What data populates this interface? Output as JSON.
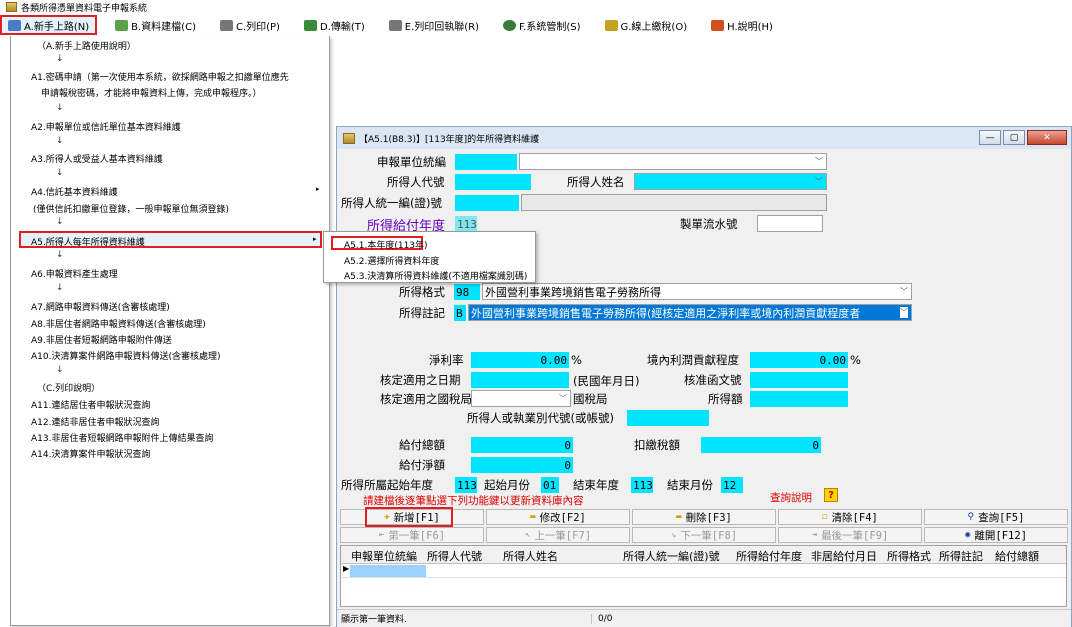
{
  "app": {
    "title": "各類所得憑單資料電子申報系統"
  },
  "menubar": {
    "items": [
      {
        "label": "A.新手上路(N)",
        "icon": "pencil-icon",
        "color": "#4a7bc8"
      },
      {
        "label": "B.資料建檔(C)",
        "icon": "form-icon",
        "color": "#5aa04a"
      },
      {
        "label": "C.列印(P)",
        "icon": "printer-icon",
        "color": "#666666"
      },
      {
        "label": "D.傳輸(T)",
        "icon": "transfer-icon",
        "color": "#3a8a3a"
      },
      {
        "label": "E.列印回執聯(R)",
        "icon": "printer-icon",
        "color": "#666666"
      },
      {
        "label": "F.系統管制(S)",
        "icon": "gear-icon",
        "color": "#3a7a3a"
      },
      {
        "label": "G.線上繳稅(O)",
        "icon": "money-icon",
        "color": "#c8a020"
      },
      {
        "label": "H.說明(H)",
        "icon": "help-icon",
        "color": "#d05020"
      }
    ]
  },
  "dropdown": {
    "items": [
      "（A.新手上路使用說明）",
      "A1.密碼申請（第一次使用本系統，欲採網路申報之扣繳單位應先",
      "申請報稅密碼，才能將申報資料上傳，完成申報程序。）",
      "A2.申報單位或信託單位基本資料維護",
      "A3.所得人或受益人基本資料維護",
      "A4.信託基本資料維護",
      "(僅供信託扣繳單位登錄，一般申報單位無須登錄)",
      "A5.所得人每年所得資料維護",
      "A6.申報資料產生處理",
      "A7.網路申報資料傳送(含審核處理)",
      "A8.非居住者網路申報資料傳送(含審核處理)",
      "A9.非居住者短報網路申報附件傳送",
      "A10.決清算案件網路申報資料傳送(含審核處理)",
      "（C.列印說明）",
      "A11.連結居住者申報狀況查詢",
      "A12.連結非居住者申報狀況查詢",
      "A13.非居住者短報網路申報附件上傳結果查詢",
      "A14.決清算案件申報狀況查詢"
    ],
    "arrow": "↓",
    "submenu_arrow": "▸"
  },
  "submenu": {
    "items": [
      "A5.1.本年度(113年)",
      "A5.2.選擇所得資料年度",
      "A5.3.決清算所得資料維護(不適用檔案識別碼)"
    ]
  },
  "window": {
    "title": "【A5.1(B8.3)】[113年度]的年所得資料維護",
    "buttons": {
      "minimize": "—",
      "maximize": "▢",
      "close": "✕"
    }
  },
  "form": {
    "unit_id_label": "申報單位統編",
    "income_code_label": "所得人代號",
    "income_name_label": "所得人姓名",
    "uid_label": "所得人統一編(證)號",
    "year_label": "所得給付年度",
    "year_value": "113",
    "serial_label": "製單流水號",
    "format_label": "所得格式",
    "format_code": "98",
    "format_value": "外國營利事業跨境銷售電子勞務所得",
    "note_label": "所得註記",
    "note_code": "B",
    "note_value": "外國營利事業跨境銷售電子勞務所得(經核定適用之淨利率或境內利潤貢獻程度者",
    "net_rate_label": "淨利率",
    "net_rate_value": "0.00",
    "percent": "%",
    "profit_label": "境內利潤貢獻程度",
    "profit_value": "0.00",
    "approve_date_label": "核定適用之日期",
    "approve_date_hint": "(民國年月日)",
    "approve_doc_label": "核准函文號",
    "tax_office_label": "核定適用之國稅局",
    "tax_office_suffix": "國稅局",
    "income_amount_label": "所得額",
    "exec_code_label": "所得人或執業別代號(或帳號)",
    "total_pay_label": "給付總額",
    "total_pay_value": "0",
    "withhold_label": "扣繳稅額",
    "withhold_value": "0",
    "net_pay_label": "給付淨額",
    "net_pay_value": "0",
    "start_year_label": "所得所屬起始年度",
    "start_year_value": "113",
    "start_month_label": "起始月份",
    "start_month_value": "01",
    "end_year_label": "結束年度",
    "end_year_value": "113",
    "end_month_label": "結束月份",
    "end_month_value": "12",
    "hint": "請建檔後逐筆點選下列功能鍵以更新資料庫內容",
    "query_help": "查詢說明",
    "help_mark": "?"
  },
  "toolbar": {
    "add": "新增[F1]",
    "edit": "修改[F2]",
    "delete": "刪除[F3]",
    "clear": "清除[F4]",
    "query": "查詢[F5]",
    "first": "第一筆[F6]",
    "prev": "上一筆[F7]",
    "next": "下一筆[F8]",
    "last": "最後一筆[F9]",
    "exit": "離開[F12]"
  },
  "grid": {
    "columns": [
      "申報單位統編",
      "所得人代號",
      "所得人姓名",
      "所得人統一編(證)號",
      "所得給付年度",
      "非居給付月日",
      "所得格式",
      "所得註記",
      "給付總額"
    ],
    "row_marker": "▶"
  },
  "status": {
    "text": "顯示第一筆資料.",
    "count": "0/0"
  },
  "colors": {
    "field": "#00e5ff",
    "highlight": "#e02020",
    "purple": "#6a00c0"
  }
}
